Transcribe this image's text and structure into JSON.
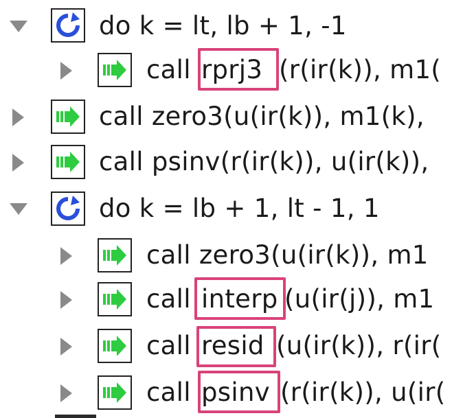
{
  "tree": {
    "rows": [
      {
        "kind": "loop",
        "icon": "loop-icon",
        "text": "do k = lt, lb + 1, -1"
      },
      {
        "kind": "call",
        "icon": "call-arrow-icon",
        "prefix": "call ",
        "name": "rprj3",
        "args": "(r(ir(k)), m1("
      },
      {
        "kind": "call",
        "icon": "call-arrow-icon",
        "text": "call zero3(u(ir(k)), m1(k),"
      },
      {
        "kind": "call",
        "icon": "call-arrow-icon",
        "text": "call psinv(r(ir(k)), u(ir(k)),"
      },
      {
        "kind": "loop",
        "icon": "loop-icon",
        "text": "do k = lb + 1, lt - 1, 1"
      },
      {
        "kind": "call",
        "icon": "call-arrow-icon",
        "text": "call zero3(u(ir(k)), m1"
      },
      {
        "kind": "call",
        "icon": "call-arrow-icon",
        "prefix": "call ",
        "name": "interp",
        "args": "(u(ir(j)), m1"
      },
      {
        "kind": "call",
        "icon": "call-arrow-icon",
        "prefix": "call ",
        "name": "resid",
        "args": "(u(ir(k)), r(ir("
      },
      {
        "kind": "call",
        "icon": "call-arrow-icon",
        "prefix": "call ",
        "name": "psinv",
        "args": "(r(ir(k)), u(ir("
      }
    ]
  },
  "colors": {
    "highlight": "#d8437a",
    "loop_arrow": "#2a4fd8",
    "call_arrow": "#2ecc40",
    "toggle": "#8a8a8a"
  }
}
